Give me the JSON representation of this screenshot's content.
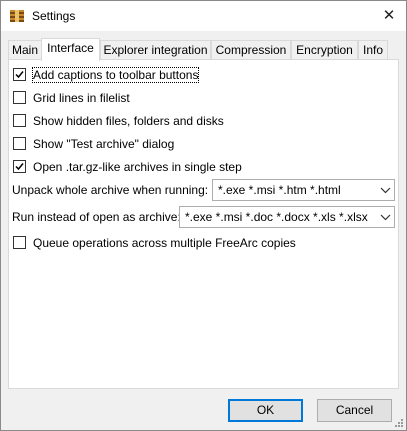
{
  "window": {
    "title": "Settings",
    "close_glyph": "✕"
  },
  "tabs": [
    {
      "label": "Main",
      "active": false
    },
    {
      "label": "Interface",
      "active": true
    },
    {
      "label": "Explorer integration",
      "active": false
    },
    {
      "label": "Compression",
      "active": false
    },
    {
      "label": "Encryption",
      "active": false
    },
    {
      "label": "Info",
      "active": false
    }
  ],
  "options": [
    {
      "label": "Add captions to toolbar buttons",
      "checked": true
    },
    {
      "label": "Grid lines in filelist",
      "checked": false
    },
    {
      "label": "Show hidden files, folders and disks",
      "checked": false
    },
    {
      "label": "Show \"Test archive\" dialog",
      "checked": false
    },
    {
      "label": "Open .tar.gz-like archives in single step",
      "checked": true
    }
  ],
  "unpack": {
    "label": "Unpack whole archive when running:",
    "value": "*.exe *.msi *.htm *.html"
  },
  "run_instead": {
    "label": "Run instead of open as archive:",
    "value": "*.exe *.msi *.doc *.docx *.xls *.xlsx"
  },
  "queue": {
    "label": "Queue operations across multiple FreeArc copies",
    "checked": false
  },
  "buttons": {
    "ok": "OK",
    "cancel": "Cancel"
  },
  "icons": {
    "app": "archive-icon",
    "close": "close-icon"
  }
}
